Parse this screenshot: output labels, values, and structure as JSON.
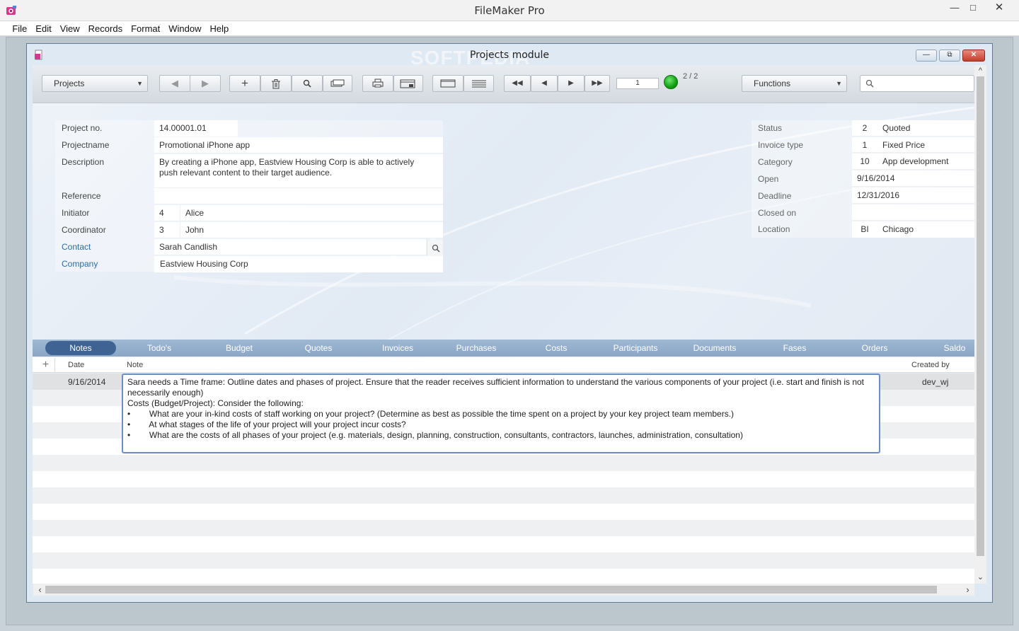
{
  "app": {
    "title": "FileMaker Pro"
  },
  "menu": [
    "File",
    "Edit",
    "View",
    "Records",
    "Format",
    "Window",
    "Help"
  ],
  "document": {
    "title": "Projects module",
    "watermark": "SOFTPEDIA"
  },
  "toolbar": {
    "layout_select": "Projects",
    "functions_select": "Functions",
    "record_number": "1",
    "record_count": "2 / 2",
    "search_placeholder": ""
  },
  "left_fields": [
    {
      "label": "Project no.",
      "value": "14.00001.01"
    },
    {
      "label": "Projectname",
      "value": "Promotional iPhone app"
    },
    {
      "label": "Description",
      "value": "By creating a iPhone app, Eastview Housing Corp is able to actively push relevant content to their target audience."
    },
    {
      "label": "Reference",
      "value": ""
    },
    {
      "label": "Initiator",
      "id": "4",
      "value": "Alice"
    },
    {
      "label": "Coordinator",
      "id": "3",
      "value": "John"
    },
    {
      "label": "Contact",
      "value": "Sarah Candlish"
    },
    {
      "label": "Company",
      "value": "Eastview Housing Corp"
    }
  ],
  "right_fields": [
    {
      "label": "Status",
      "id": "2",
      "value": "Quoted"
    },
    {
      "label": "Invoice type",
      "id": "1",
      "value": "Fixed Price"
    },
    {
      "label": "Category",
      "id": "10",
      "value": "App development"
    },
    {
      "label": "Open",
      "value": "9/16/2014"
    },
    {
      "label": "Deadline",
      "value": "12/31/2016"
    },
    {
      "label": "Closed on",
      "value": ""
    },
    {
      "label": "Location",
      "id": "BI",
      "value": "Chicago"
    }
  ],
  "tabs": [
    "Notes",
    "Todo's",
    "Budget",
    "Quotes",
    "Invoices",
    "Purchases",
    "Costs",
    "Participants",
    "Documents",
    "Fases",
    "Orders",
    "Saldo"
  ],
  "notes": {
    "columns": {
      "date": "Date",
      "note": "Note",
      "created_by": "Created by"
    },
    "rows": [
      {
        "date": "9/16/2014",
        "created_by": "dev_wj",
        "note": "Sara needs a Time frame: Outline dates and phases of project. Ensure that the reader receives sufficient information to understand the various components of your project (i.e. start and finish is not necessarily enough)\nCosts (Budget/Project): Consider the following:\n•        What are your in-kind costs of staff working on your project? (Determine as best as possible the time spent on a project by your key project team members.)\n•        At what stages of the life of your project will your project incur costs?\n•        What are the costs of all phases of your project (e.g. materials, design, planning, construction, consultants, contractors, launches, administration, consultation)"
      }
    ]
  },
  "colors": {
    "accent": "#3f6494",
    "tabbar": "#8aa6c4",
    "link": "#2b6ca3",
    "status_green": "#11a011"
  }
}
